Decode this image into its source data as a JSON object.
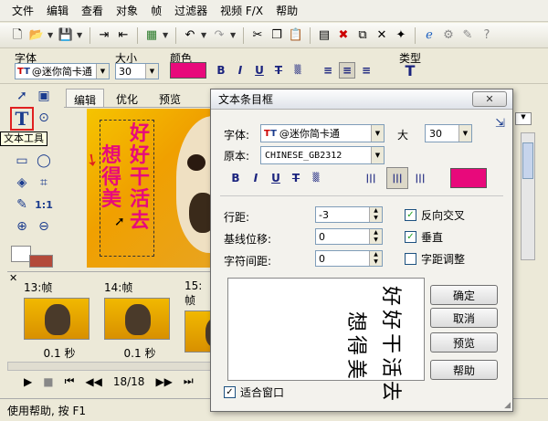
{
  "menu": [
    "文件",
    "编辑",
    "查看",
    "对象",
    "帧",
    "过滤器",
    "视频 F/X",
    "帮助"
  ],
  "props": {
    "font_label": "字体",
    "font_value": "@迷你简卡通",
    "size_label": "大小",
    "size_value": "30",
    "color_label": "颜色",
    "type_label": "类型"
  },
  "tooltip": "文本工具",
  "tabs": [
    "编辑",
    "优化",
    "预览"
  ],
  "canvas": {
    "columns": [
      [
        "好",
        "好",
        "干",
        "活",
        "去"
      ],
      [
        "想",
        "得",
        "美"
      ]
    ]
  },
  "timeline": {
    "frames": [
      {
        "label": "13:帧",
        "duration": "0.1 秒"
      },
      {
        "label": "14:帧",
        "duration": "0.1 秒"
      },
      {
        "label": "15:帧",
        "duration": ""
      }
    ],
    "counter": "18/18"
  },
  "status": "使用帮助, 按 F1",
  "dialog": {
    "title": "文本条目框",
    "font_label": "字体:",
    "font_value": "@迷你简卡通",
    "size_label": "大",
    "size_value": "30",
    "script_label": "原本:",
    "script_value": "CHINESE_GB2312",
    "line_spacing_label": "行距:",
    "line_spacing_value": "-3",
    "baseline_label": "基线位移:",
    "baseline_value": "0",
    "char_spacing_label": "字符间距:",
    "char_spacing_value": "0",
    "reverse_label": "反向交叉",
    "reverse_checked": true,
    "vertical_label": "垂直",
    "vertical_checked": true,
    "kerning_label": "字距调整",
    "kerning_checked": false,
    "fit_label": "适合窗口",
    "fit_checked": true,
    "buttons": {
      "ok": "确定",
      "cancel": "取消",
      "preview": "预览",
      "help": "帮助"
    },
    "preview_columns": [
      [
        "好",
        "好",
        "干",
        "活",
        "去"
      ],
      [
        "想",
        "得",
        "美"
      ]
    ]
  },
  "colors": {
    "text_color": "#e8097b",
    "accent": "#1b3c8e"
  }
}
